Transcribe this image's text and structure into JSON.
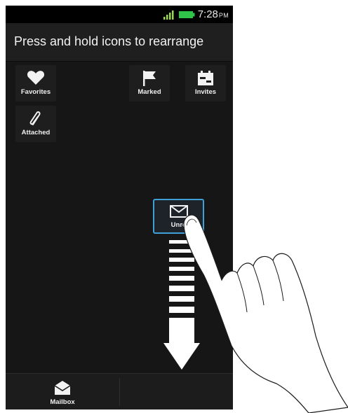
{
  "status_bar": {
    "time": "7:28",
    "ampm": "PM",
    "icons": [
      "signal-icon",
      "battery-icon"
    ]
  },
  "header": {
    "title": "Press and hold icons to rearrange"
  },
  "tiles": {
    "favorites": {
      "label": "Favorites",
      "icon": "heart-icon"
    },
    "marked": {
      "label": "Marked",
      "icon": "flag-icon"
    },
    "invites": {
      "label": "Invites",
      "icon": "calendar-icon"
    },
    "attached": {
      "label": "Attached",
      "icon": "paperclip-icon"
    },
    "unread": {
      "label": "Unre",
      "icon": "envelope-icon"
    }
  },
  "bottom_bar": {
    "mailbox_label": "Mailbox",
    "mailbox_icon": "open-envelope-icon"
  },
  "colors": {
    "background": "#161616",
    "tile": "#1e1e1e",
    "accent": "#3ea0d6",
    "battery": "#2fc34a",
    "signal": "#9bd84b"
  }
}
